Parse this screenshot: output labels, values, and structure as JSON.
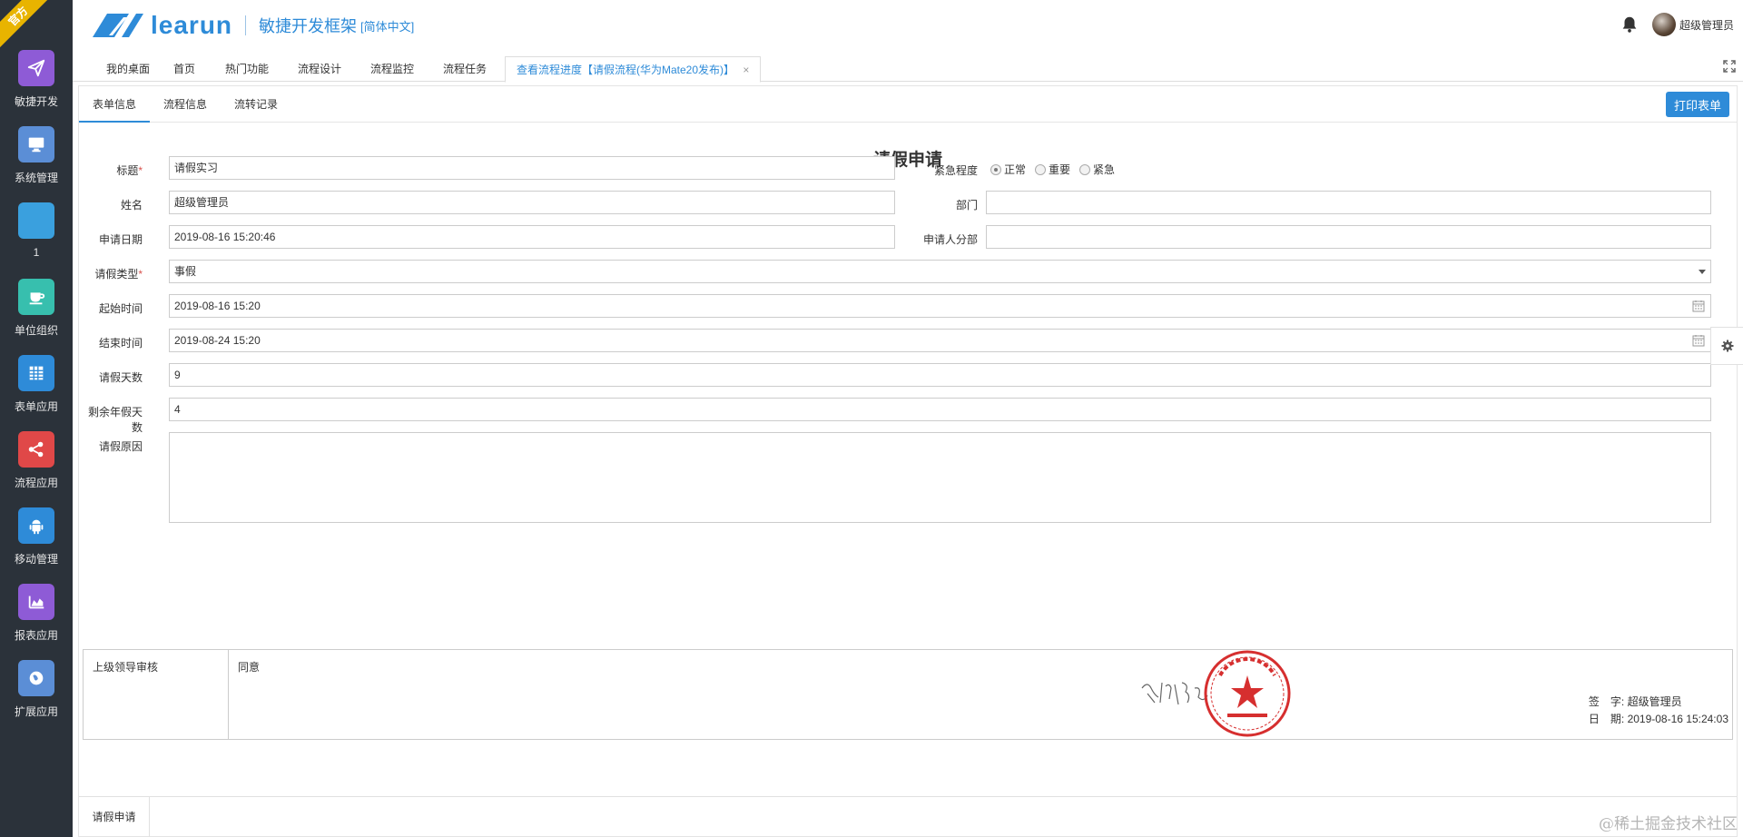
{
  "ribbon": "官方",
  "sidebar": {
    "items": [
      {
        "label": "敏捷开发",
        "icon": "paper-plane-icon",
        "color": "#8e5bd6"
      },
      {
        "label": "系统管理",
        "icon": "monitor-icon",
        "color": "#5b8ed6"
      },
      {
        "label": "1",
        "icon": "blank-icon",
        "color": "#3aa0de"
      },
      {
        "label": "单位组织",
        "icon": "coffee-icon",
        "color": "#37bfae"
      },
      {
        "label": "表单应用",
        "icon": "table-icon",
        "color": "#2e8bd8"
      },
      {
        "label": "流程应用",
        "icon": "share-icon",
        "color": "#e04848"
      },
      {
        "label": "移动管理",
        "icon": "android-icon",
        "color": "#2e8bd8"
      },
      {
        "label": "报表应用",
        "icon": "area-chart-icon",
        "color": "#8e5bd6"
      },
      {
        "label": "扩展应用",
        "icon": "globe-icon",
        "color": "#5b8ed6"
      }
    ]
  },
  "header": {
    "logo_text": "learun",
    "subtitle": "敏捷开发框架",
    "lang": "[简体中文]",
    "user": "超级管理员"
  },
  "tabs": [
    {
      "label": "我的桌面"
    },
    {
      "label": "首页"
    },
    {
      "label": "热门功能"
    },
    {
      "label": "流程设计"
    },
    {
      "label": "流程监控"
    },
    {
      "label": "流程任务"
    },
    {
      "label": "查看流程进度【请假流程(华为Mate20发布)】",
      "active": true
    }
  ],
  "subtabs": [
    {
      "label": "表单信息",
      "active": true
    },
    {
      "label": "流程信息"
    },
    {
      "label": "流转记录"
    }
  ],
  "print_label": "打印表单",
  "form": {
    "title": "请假申请",
    "title_label": "标题",
    "title_value": "请假实习",
    "urgency_label": "紧急程度",
    "urgency_options": [
      "正常",
      "重要",
      "紧急"
    ],
    "urgency_selected": "正常",
    "name_label": "姓名",
    "name_value": "超级管理员",
    "dept_label": "部门",
    "dept_value": "",
    "apply_date_label": "申请日期",
    "apply_date_value": "2019-08-16 15:20:46",
    "applicant_dept_label": "申请人分部",
    "applicant_dept_value": "",
    "leave_type_label": "请假类型",
    "leave_type_value": "事假",
    "start_label": "起始时间",
    "start_value": "2019-08-16 15:20",
    "end_label": "结束时间",
    "end_value": "2019-08-24 15:20",
    "days_label": "请假天数",
    "days_value": "9",
    "remaining_label": "剩余年假天数",
    "remaining_value": "4",
    "reason_label": "请假原因",
    "reason_value": ""
  },
  "approval": {
    "label": "上级领导审核",
    "opinion": "同意",
    "sign_label": "签　字:",
    "sign_value": "超级管理员",
    "date_label": "日　期:",
    "date_value": "2019-08-16 15:24:03"
  },
  "bottom_label": "请假申请",
  "watermark": "@稀土掘金技术社区"
}
